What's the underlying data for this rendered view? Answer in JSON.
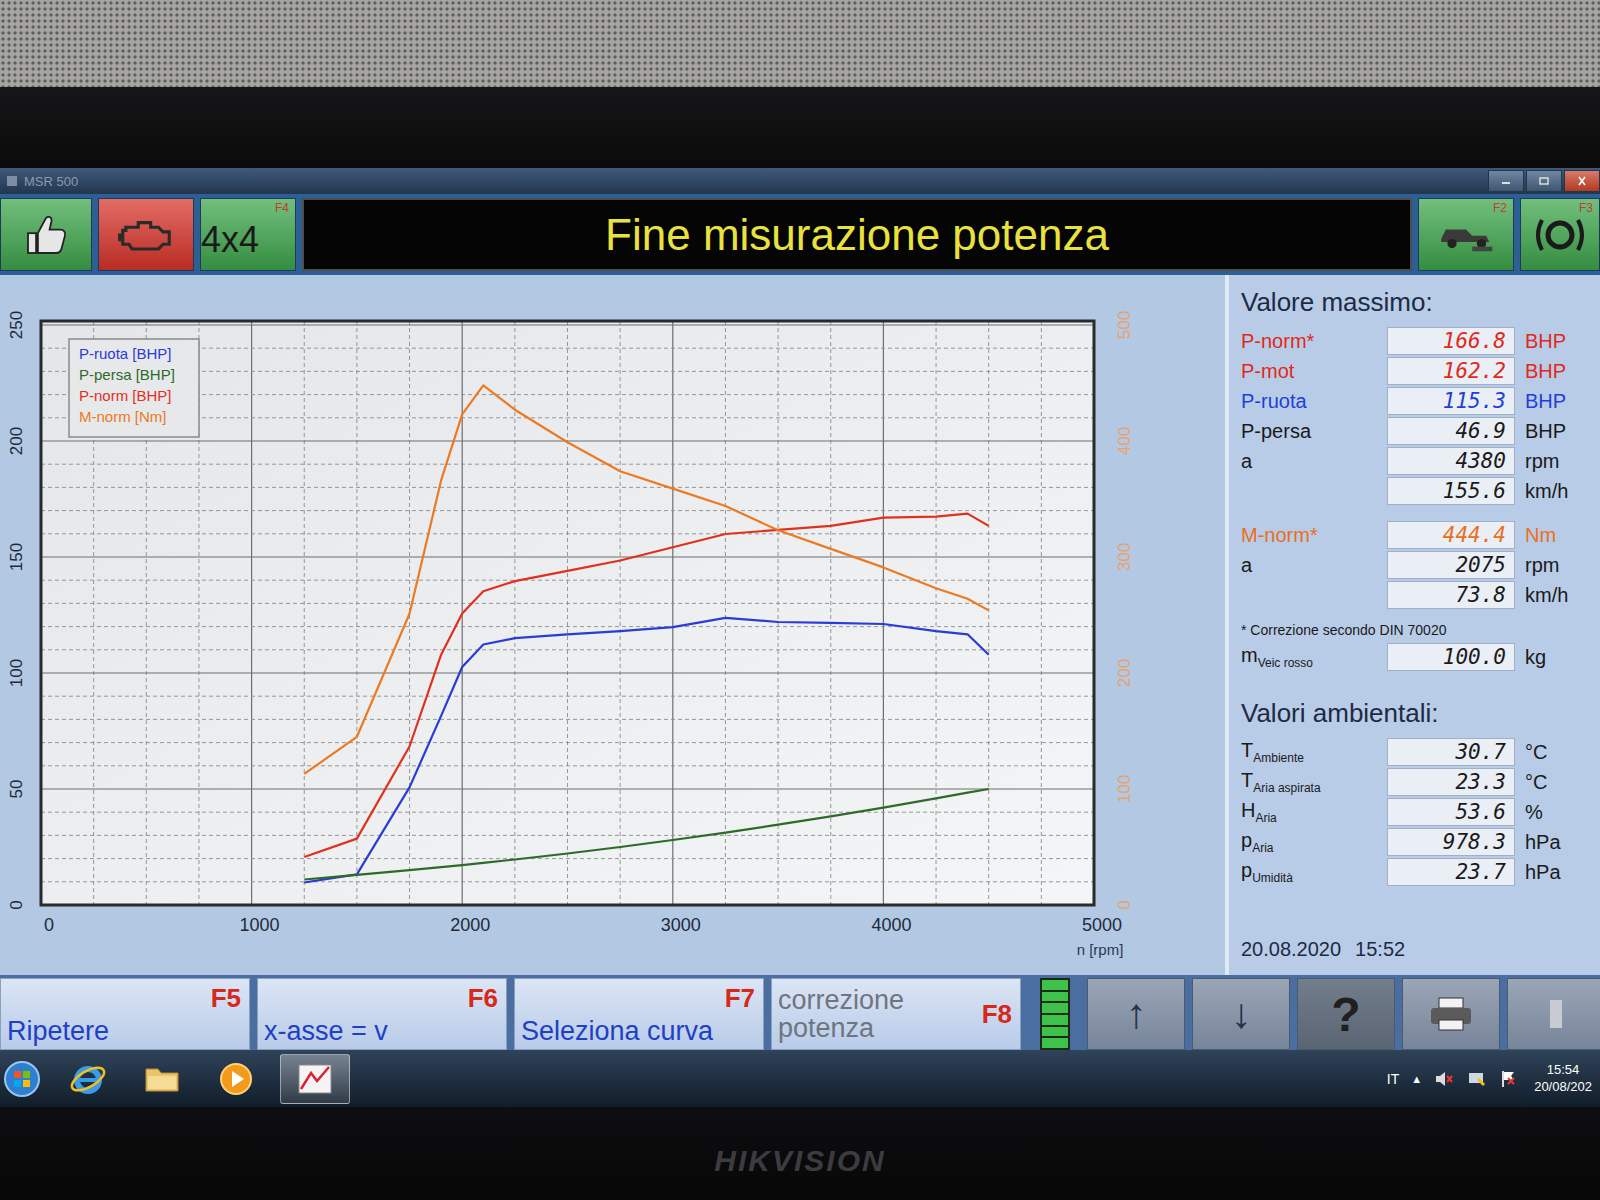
{
  "window": {
    "title": "MSR 500"
  },
  "toolbar": {
    "left": [
      {
        "kind": "thumbs",
        "color": "#3da64b"
      },
      {
        "kind": "engine",
        "color": "#d8342a"
      },
      {
        "kind": "text",
        "label": "4x4",
        "key": "F4",
        "color": "#3da64b"
      }
    ],
    "status": "Fine misurazione potenza",
    "right": [
      {
        "kind": "dyno",
        "key": "F2",
        "color": "#3da64b"
      },
      {
        "kind": "roller",
        "key": "F3",
        "color": "#3da64b"
      }
    ]
  },
  "chart": {
    "y_left_ticks": [
      "0",
      "50",
      "100",
      "150",
      "200",
      "250"
    ],
    "y_right_ticks": [
      "0",
      "100",
      "200",
      "300",
      "400",
      "500"
    ],
    "x_ticks": [
      "0",
      "1000",
      "2000",
      "3000",
      "4000",
      "5000"
    ],
    "x_label": "n [rpm]",
    "rpm": [
      1250,
      1500,
      1750,
      1900,
      2000,
      2100,
      2250,
      2500,
      2750,
      3000,
      3250,
      3500,
      3750,
      4000,
      4250,
      4400,
      4500
    ],
    "series": [
      {
        "label": "P-ruota [BHP]",
        "axis": "left",
        "color": "#2a3bd6",
        "values": [
          9.7,
          13.2,
          50.7,
          81.5,
          102.6,
          112.3,
          115,
          116.7,
          118,
          119.8,
          123.8,
          122,
          121.6,
          121.1,
          118,
          116.7,
          107.9
        ]
      },
      {
        "label": "P-persa [BHP]",
        "axis": "left",
        "color": "#2f6a2a",
        "values": [
          11,
          13,
          15,
          16.3,
          17.2,
          18.2,
          19.6,
          22.2,
          25,
          28,
          31.2,
          34.6,
          38.2,
          42,
          46,
          48.4,
          50
        ]
      },
      {
        "label": "P-norm [BHP]",
        "axis": "left",
        "color": "#e2301e",
        "values": [
          20.7,
          28.6,
          68.3,
          107.9,
          125.6,
          135.2,
          139.6,
          144,
          148.5,
          154.2,
          159.9,
          161.7,
          163.4,
          167,
          167.4,
          168.7,
          163.4
        ]
      },
      {
        "label": "M-norm [Nm]",
        "axis": "right",
        "color": "#ec7a22",
        "values": [
          113,
          145,
          251,
          366,
          423,
          448,
          427,
          399,
          374,
          359,
          344,
          323,
          307,
          291,
          273,
          264,
          254
        ]
      }
    ]
  },
  "max_values": {
    "title": "Valore massimo:",
    "rows": [
      {
        "label": "P-norm*",
        "value": "166.8",
        "unit": "BHP",
        "color": "#e0291a"
      },
      {
        "label": "P-mot",
        "value": "162.2",
        "unit": "BHP",
        "color": "#e0291a"
      },
      {
        "label": "P-ruota",
        "value": "115.3",
        "unit": "BHP",
        "color": "#1f3fd8"
      },
      {
        "label": "P-persa",
        "value": "46.9",
        "unit": "BHP",
        "color": "#1a1a1a"
      },
      {
        "label": "a",
        "value": "4380",
        "unit": "rpm",
        "color": "#1a1a1a"
      },
      {
        "value": "155.6",
        "unit": "km/h",
        "color": "#1a1a1a"
      }
    ],
    "torque_rows": [
      {
        "label": "M-norm*",
        "value": "444.4",
        "unit": "Nm",
        "color": "#ea6f1c"
      },
      {
        "label": "a",
        "value": "2075",
        "unit": "rpm",
        "color": "#1a1a1a"
      },
      {
        "value": "73.8",
        "unit": "km/h",
        "color": "#1a1a1a"
      }
    ],
    "footnote": "* Correzione secondo DIN 70020",
    "mass": {
      "symbol": "m",
      "sub": "Veic rosso",
      "value": "100.0",
      "unit": "kg"
    }
  },
  "ambient": {
    "title": "Valori ambientali:",
    "rows": [
      {
        "symbol": "T",
        "sub": "Ambiente",
        "value": "30.7",
        "unit": "°C"
      },
      {
        "symbol": "T",
        "sub": "Aria aspirata",
        "value": "23.3",
        "unit": "°C"
      },
      {
        "symbol": "H",
        "sub": "Aria",
        "value": "53.6",
        "unit": "%"
      },
      {
        "symbol": "p",
        "sub": "Aria",
        "value": "978.3",
        "unit": "hPa"
      },
      {
        "symbol": "p",
        "sub": "Umidità",
        "value": "23.7",
        "unit": "hPa"
      }
    ],
    "date": "20.08.2020",
    "time": "15:52"
  },
  "function_keys": [
    {
      "label": "Ripetere",
      "key": "F5",
      "disabled": false
    },
    {
      "label": "x-asse = v",
      "key": "F6",
      "disabled": false
    },
    {
      "label": "Seleziona curva",
      "key": "F7",
      "disabled": false
    },
    {
      "label": "correzione potenza",
      "key": "F8",
      "disabled": true
    }
  ],
  "level_meter": {
    "level": 1
  },
  "nav_buttons": [
    {
      "kind": "up",
      "label": "↑"
    },
    {
      "kind": "down",
      "label": "↓"
    },
    {
      "kind": "help",
      "label": "?"
    },
    {
      "kind": "print"
    },
    {
      "kind": "blank"
    }
  ],
  "taskbar": {
    "apps": [
      {
        "kind": "start",
        "active": false
      },
      {
        "kind": "ie",
        "active": false
      },
      {
        "kind": "explorer",
        "active": false
      },
      {
        "kind": "media",
        "active": false
      },
      {
        "kind": "msr",
        "active": true
      }
    ],
    "language": "IT",
    "tray_arrow": "▲",
    "time": "15:54",
    "date": "20/08/202"
  },
  "bezel": {
    "brand": "HIKVISION"
  }
}
